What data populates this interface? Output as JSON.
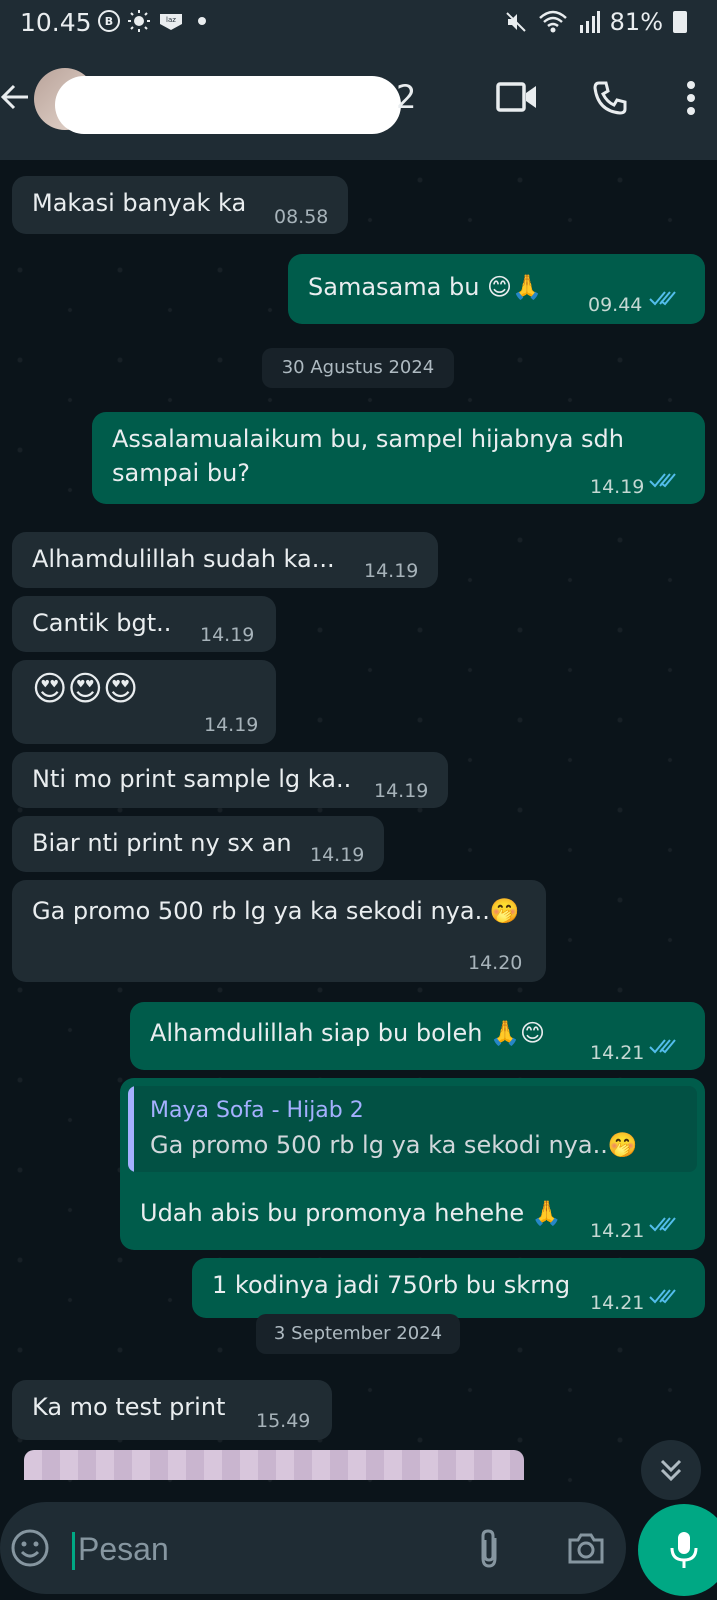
{
  "status_bar": {
    "time": "10.45",
    "battery": "81%",
    "icons": [
      "b-icon",
      "brightness-icon",
      "laz-icon",
      "dot-icon",
      "mute-icon",
      "wifi-icon",
      "signal-icon",
      "battery-icon"
    ]
  },
  "header": {
    "contact_name_suffix": "2",
    "icons": [
      "back-arrow-icon",
      "avatar",
      "video-call-icon",
      "voice-call-icon",
      "more-menu-icon"
    ]
  },
  "messages": [
    {
      "dir": "in",
      "text": "Makasi banyak ka",
      "time": "08.58"
    },
    {
      "dir": "out",
      "text": "Samasama bu 😊🙏",
      "time": "09.44"
    },
    {
      "type": "date",
      "text": "30 Agustus 2024"
    },
    {
      "dir": "out",
      "text_line1": "Assalamualaikum bu, sampel hijabnya sdh",
      "text_line2": "sampai bu?",
      "time": "14.19"
    },
    {
      "dir": "in",
      "text": "Alhamdulillah sudah ka...",
      "time": "14.19"
    },
    {
      "dir": "in",
      "text": "Cantik bgt..",
      "time": "14.19"
    },
    {
      "dir": "in",
      "text": "😍😍😍",
      "time": "14.19"
    },
    {
      "dir": "in",
      "text": "Nti mo print sample lg ka..",
      "time": "14.19"
    },
    {
      "dir": "in",
      "text": "Biar nti print ny sx an",
      "time": "14.19"
    },
    {
      "dir": "in",
      "text": "Ga promo 500 rb lg ya ka sekodi nya..🤭",
      "time": "14.20"
    },
    {
      "dir": "out",
      "text": "Alhamdulillah siap bu boleh 🙏😊",
      "time": "14.21"
    },
    {
      "dir": "out",
      "quote_name": "Maya Sofa - Hijab 2",
      "quote_text": "Ga promo 500 rb lg ya ka sekodi nya..🤭",
      "text": "Udah abis bu promonya hehehe 🙏",
      "time": "14.21"
    },
    {
      "dir": "out",
      "text": "1 kodinya jadi 750rb bu skrng",
      "time": "14.21"
    },
    {
      "type": "date",
      "text": "3 September 2024"
    },
    {
      "dir": "in",
      "text": "Ka mo test print",
      "time": "15.49"
    }
  ],
  "input": {
    "placeholder": "Pesan"
  },
  "colors": {
    "incoming": "#202c33",
    "outgoing": "#005c4b",
    "accent": "#00a884",
    "read_ticks": "#53bdeb"
  }
}
